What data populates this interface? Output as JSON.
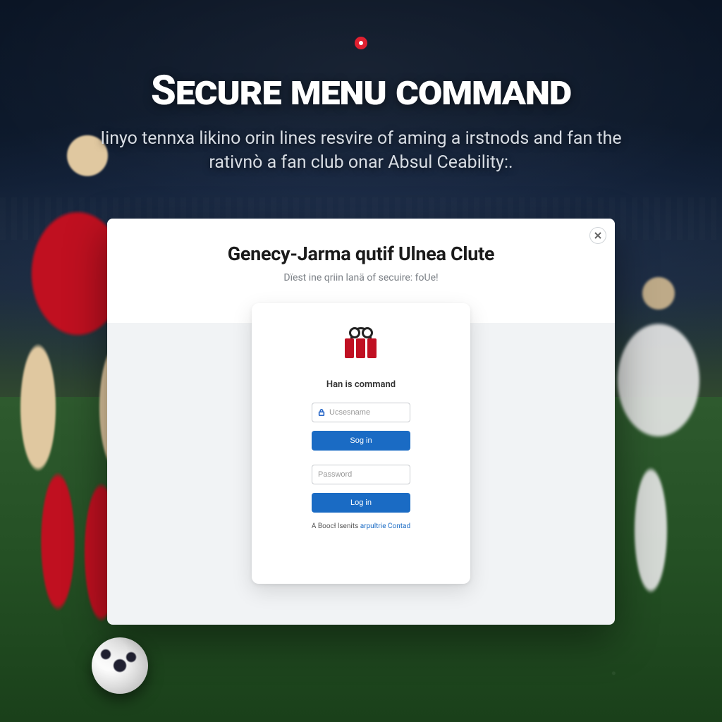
{
  "hero": {
    "title": "Secure menu command",
    "subtitle": "Iinyo tennxa likino orin lines resvire of aming a irstnods and fan the rativnò a fan club onar Absul Ceability:."
  },
  "modal": {
    "title": "Genecy-Jarma qutif Ulnea Clute",
    "subtitle": "Dïest ine qriin lanä of secuire: foUe!"
  },
  "card": {
    "label": "Han is command",
    "username_placeholder": "Ucsesname",
    "signin_label": "Sog in",
    "password_placeholder": "Password",
    "login_label": "Log in",
    "footer_prefix": "A Boocł lsenits ",
    "footer_link": "arpultrie Contad"
  },
  "icons": {
    "hero_badge": "badge-icon",
    "close": "close-icon",
    "lock": "lock-icon",
    "logo": "gift-logo-icon"
  },
  "colors": {
    "accent_red": "#c01022",
    "accent_blue": "#1a6bc4"
  }
}
